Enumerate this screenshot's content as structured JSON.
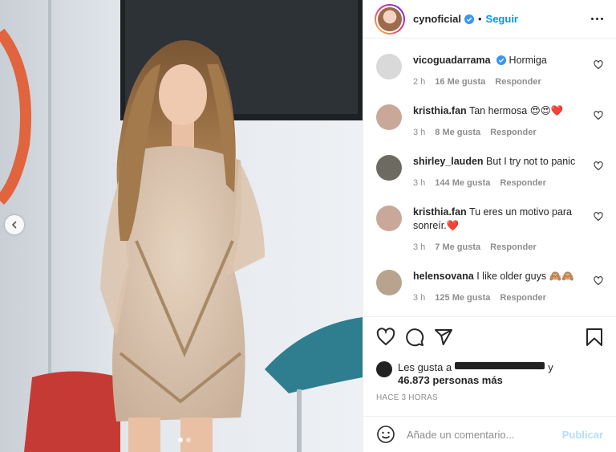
{
  "post": {
    "username": "cynoficial",
    "separator": "•",
    "follow_label": "Seguir"
  },
  "comments": [
    {
      "user": "vicoguadarrama",
      "verified": true,
      "text": "Hormiga",
      "time": "2 h",
      "likes": "16 Me gusta",
      "reply": "Responder",
      "avatar_color": "#d9d9d9"
    },
    {
      "user": "kristhia.fan",
      "verified": false,
      "text": "Tan hermosa",
      "emojis": "😍😍❤️",
      "time": "3 h",
      "likes": "8 Me gusta",
      "reply": "Responder",
      "avatar_color": "#c9a89a"
    },
    {
      "user": "shirley_lauden",
      "verified": false,
      "text": "But I try not to panic",
      "time": "3 h",
      "likes": "144 Me gusta",
      "reply": "Responder",
      "avatar_color": "#6d6a62"
    },
    {
      "user": "kristhia.fan",
      "verified": false,
      "text": "Tu eres un motivo para sonreír.",
      "emojis": "❤️",
      "time": "3 h",
      "likes": "7 Me gusta",
      "reply": "Responder",
      "avatar_color": "#c9a89a"
    },
    {
      "user": "helensovana",
      "verified": false,
      "text": "I like older guys",
      "emojis": "🙈🙈",
      "time": "3 h",
      "likes": "125 Me gusta",
      "reply": "Responder",
      "avatar_color": "#b8a48e"
    }
  ],
  "likes": {
    "prefix": "Les gusta a",
    "suffix": "y",
    "count": "46.873 personas más"
  },
  "timestamp": "HACE 3 HORAS",
  "add_comment": {
    "placeholder": "Añade un comentario...",
    "publish_label": "Publicar"
  },
  "colors": {
    "link": "#0095f6",
    "publish_disabled": "#b2dffc",
    "secondary_text": "#8e8e8e"
  },
  "icons": [
    "verified-icon",
    "more-icon",
    "heart-icon",
    "comment-icon",
    "share-icon",
    "bookmark-icon",
    "emoji-icon",
    "chevron-left-icon"
  ]
}
